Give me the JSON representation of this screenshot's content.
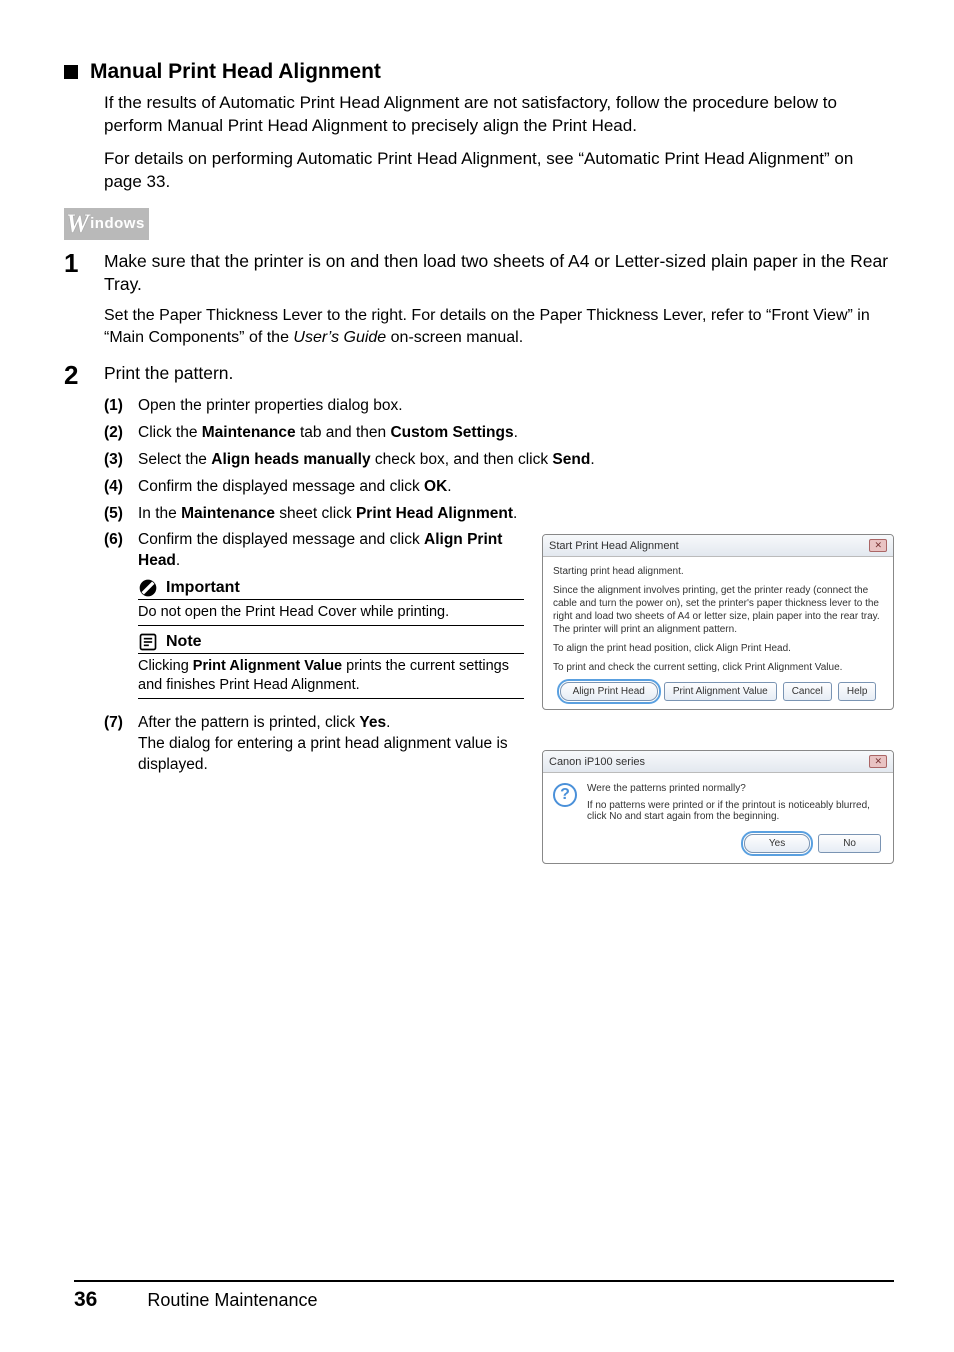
{
  "section": {
    "title": "Manual Print Head Alignment",
    "intro1": "If the results of Automatic Print Head Alignment are not satisfactory, follow the procedure below to perform Manual Print Head Alignment to precisely align the Print Head.",
    "intro2": "For details on performing Automatic Print Head Alignment, see “Automatic Print Head Alignment” on page 33."
  },
  "os": {
    "w": "W",
    "rest": "indows"
  },
  "step1": {
    "num": "1",
    "main": "Make sure that the printer is on and then load two sheets of A4 or Letter-sized plain paper in the Rear Tray.",
    "sub_a": "Set the Paper Thickness Lever to the right. For details on the Paper Thickness Lever, refer to “Front View” in “Main Components” of the ",
    "sub_i": "User’s Guide",
    "sub_b": " on-screen manual."
  },
  "step2": {
    "num": "2",
    "main": "Print the pattern.",
    "items": {
      "n1": "(1)",
      "t1": "Open the printer properties dialog box.",
      "n2": "(2)",
      "t2a": "Click the ",
      "t2b": "Maintenance",
      "t2c": " tab and then ",
      "t2d": "Custom Settings",
      "t2e": ".",
      "n3": "(3)",
      "t3a": "Select the ",
      "t3b": "Align heads manually",
      "t3c": " check box, and then click ",
      "t3d": "Send",
      "t3e": ".",
      "n4": "(4)",
      "t4a": "Confirm the displayed message and click ",
      "t4b": "OK",
      "t4c": ".",
      "n5": "(5)",
      "t5a": "In the ",
      "t5b": "Maintenance",
      "t5c": " sheet click ",
      "t5d": "Print Head Alignment",
      "t5e": ".",
      "n6": "(6)",
      "t6a": "Confirm the displayed message and click ",
      "t6b": "Align Print Head",
      "t6c": ".",
      "n7": "(7)",
      "t7a": "After the pattern is printed, click ",
      "t7b": "Yes",
      "t7c": ".",
      "t7d": "The dialog for entering a print head alignment value is displayed."
    }
  },
  "important": {
    "title": "Important",
    "body": "Do not open the Print Head Cover while printing."
  },
  "note": {
    "title": "Note",
    "body_a": "Clicking ",
    "body_b": "Print Alignment Value",
    "body_c": " prints the current settings and finishes Print Head Alignment."
  },
  "dialog1": {
    "title": "Start Print Head Alignment",
    "close": "✕",
    "p1": "Starting print head alignment.",
    "p2": "Since the alignment involves printing, get the printer ready (connect the cable and turn the power on), set the printer's paper thickness lever to the right and load two sheets of A4 or letter size, plain paper into the rear tray. The printer will print an alignment pattern.",
    "p3": "To align the print head position, click Align Print Head.",
    "p4": "To print and check the current setting, click Print Alignment Value.",
    "b1": "Align Print Head",
    "b2": "Print Alignment Value",
    "b3": "Cancel",
    "b4": "Help"
  },
  "dialog2": {
    "title": "Canon iP100 series",
    "close": "✕",
    "q": "?",
    "p1": "Were the patterns printed normally?",
    "p2": "If no patterns were printed or if the printout is noticeably blurred, click No and start again from the beginning.",
    "b1": "Yes",
    "b2": "No"
  },
  "footer": {
    "page": "36",
    "label": "Routine Maintenance"
  }
}
